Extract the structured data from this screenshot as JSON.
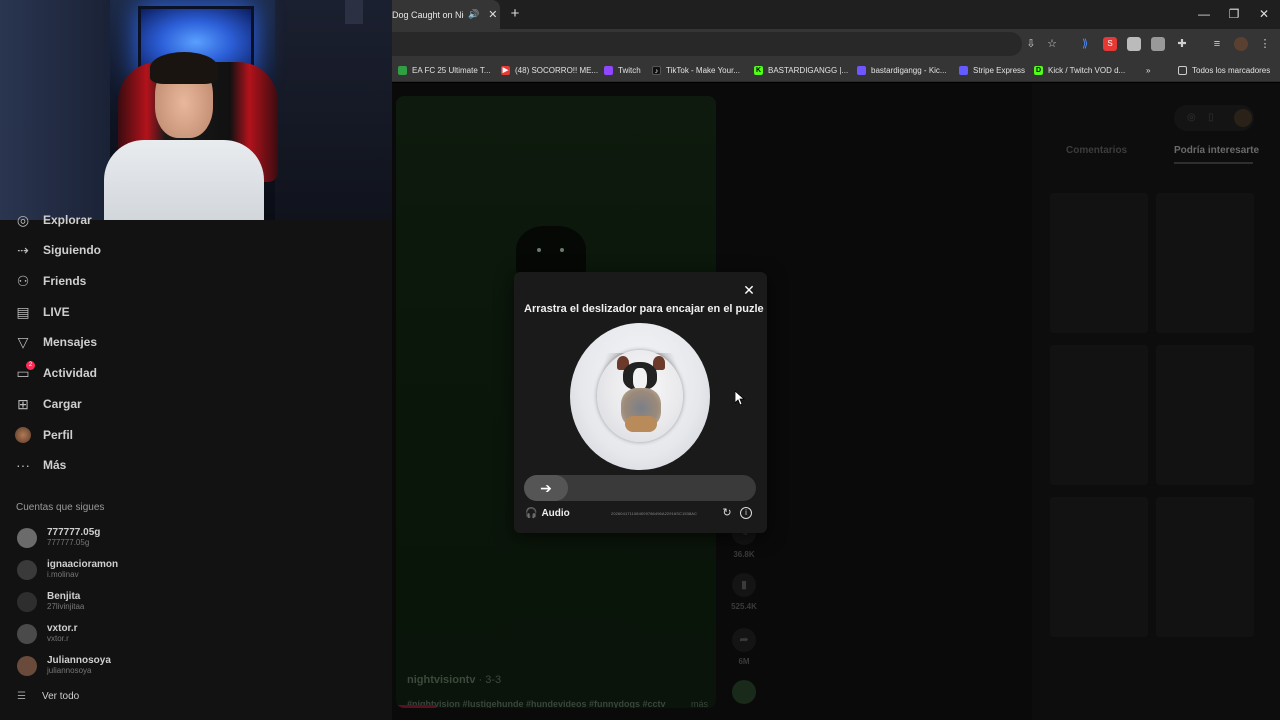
{
  "browser": {
    "tab_title": "Dog Caught on Nigh",
    "bookmarks": [
      {
        "label": "EA FC 25 Ultimate T...",
        "color": "#2ea043"
      },
      {
        "label": "(48) SOCORRO!! ME...",
        "color": "#e53935"
      },
      {
        "label": "Twitch",
        "color": "#9146ff"
      },
      {
        "label": "TikTok - Make Your...",
        "color": "#111111"
      },
      {
        "label": "BASTARDIGANGG |...",
        "color": "#53fc18"
      },
      {
        "label": "bastardigangg - Kic...",
        "color": "#6f57ff"
      },
      {
        "label": "Stripe Express",
        "color": "#635bff"
      },
      {
        "label": "Kick / Twitch VOD d...",
        "color": "#53fc18"
      }
    ],
    "all_bookmarks_label": "Todos los marcadores"
  },
  "sidebar": {
    "nav": [
      {
        "label": "Explorar",
        "icon": "compass-icon"
      },
      {
        "label": "Siguiendo",
        "icon": "following-icon"
      },
      {
        "label": "Friends",
        "icon": "friends-icon"
      },
      {
        "label": "LIVE",
        "icon": "live-icon"
      },
      {
        "label": "Mensajes",
        "icon": "messages-icon"
      },
      {
        "label": "Actividad",
        "icon": "activity-icon",
        "badge": "2"
      },
      {
        "label": "Cargar",
        "icon": "upload-icon"
      },
      {
        "label": "Perfil",
        "icon": "profile-avatar"
      },
      {
        "label": "Más",
        "icon": "more-icon"
      }
    ],
    "following_title": "Cuentas que sigues",
    "following": [
      {
        "name": "777777.05g",
        "user": "777777.05g",
        "color": "#6b6b6b"
      },
      {
        "name": "ignaacioramon",
        "user": "i.molinav",
        "color": "#3a3a3a"
      },
      {
        "name": "Benjita",
        "user": "27livinjitaa",
        "color": "#2e2e2e"
      },
      {
        "name": "vxtor.r",
        "user": "vxtor.r",
        "color": "#4a4a4a"
      },
      {
        "name": "Juliannosoya",
        "user": "juliannosoya",
        "color": "#6a4a3a"
      }
    ],
    "see_all": "Ver todo"
  },
  "video": {
    "author": "nightvisiontv",
    "date": "· 3-3",
    "tags": "#nightvision #lustigehunde #hundevideos #funnydogs #cctv",
    "more": "más",
    "counts": {
      "comments": "36.8K",
      "saves": "525.4K",
      "shares": "6M"
    }
  },
  "right_panel": {
    "tab_comments": "Comentarios",
    "tab_related": "Podría interesarte"
  },
  "captcha": {
    "title": "Arrastra el deslizador para encajar en el puzle",
    "audio_label": "Audio",
    "code": "2026041711084009786496A22916SC1538AC",
    "slider_value": 0
  }
}
